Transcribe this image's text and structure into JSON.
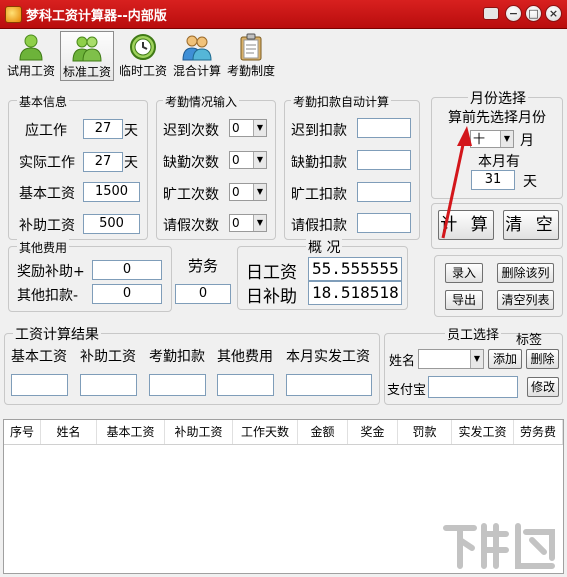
{
  "window": {
    "title": "梦科工资计算器--内部版"
  },
  "toolbar": [
    {
      "label": "试用工资",
      "icon": "person-icon"
    },
    {
      "label": "标准工资",
      "icon": "people-icon"
    },
    {
      "label": "临时工资",
      "icon": "clock-icon"
    },
    {
      "label": "混合计算",
      "icon": "users-icon"
    },
    {
      "label": "考勤制度",
      "icon": "clipboard-icon"
    }
  ],
  "basic": {
    "legend": "基本信息",
    "work_label": "应工作",
    "work_value": "27",
    "work_unit": "天",
    "actual_label": "实际工作",
    "actual_value": "27",
    "actual_unit": "天",
    "base_label": "基本工资",
    "base_value": "1500",
    "subsidy_label": "补助工资",
    "subsidy_value": "500"
  },
  "attendance": {
    "legend": "考勤情况输入",
    "rows": [
      {
        "label": "迟到次数",
        "value": "0"
      },
      {
        "label": "缺勤次数",
        "value": "0"
      },
      {
        "label": "旷工次数",
        "value": "0"
      },
      {
        "label": "请假次数",
        "value": "0"
      }
    ]
  },
  "deduction": {
    "legend": "考勤扣款自动计算",
    "rows": [
      {
        "label": "迟到扣款",
        "value": ""
      },
      {
        "label": "缺勤扣款",
        "value": ""
      },
      {
        "label": "旷工扣款",
        "value": ""
      },
      {
        "label": "请假扣款",
        "value": ""
      }
    ]
  },
  "month": {
    "legend": "月份选择",
    "hint": "算前先选择月份",
    "selected": "十",
    "unit": "月",
    "days_label": "本月有",
    "days_value": "31",
    "days_unit": "天"
  },
  "actions": {
    "calc": "计 算",
    "clear": "清 空"
  },
  "other_fees": {
    "legend": "其他费用",
    "bonus_label": "奖励补助+",
    "bonus_value": "0",
    "other_label": "其他扣款-",
    "other_value": "0"
  },
  "labor": {
    "label": "劳务",
    "value": "0"
  },
  "summary": {
    "legend": "概 况",
    "daily_wage_label": "日工资",
    "daily_wage_value": "55.555555",
    "daily_subsidy_label": "日补助",
    "daily_subsidy_value": "18.518518"
  },
  "record_buttons": {
    "enter": "录入",
    "delete_row": "删除该列",
    "export": "导出",
    "clear_list": "清空列表"
  },
  "result": {
    "legend": "工资计算结果",
    "columns": [
      "基本工资",
      "补助工资",
      "考勤扣款",
      "其他费用",
      "本月实发工资"
    ]
  },
  "employee": {
    "legend": "员工选择",
    "tag_label": "标签",
    "name_label": "姓名",
    "add": "添加",
    "delete": "删除",
    "alipay_label": "支付宝",
    "modify": "修改"
  },
  "table": {
    "columns": [
      "序号",
      "姓名",
      "基本工资",
      "补助工资",
      "工作天数",
      "金额",
      "奖金",
      "罚款",
      "实发工资",
      "劳务费"
    ]
  },
  "watermark": {
    "text": "下载吧"
  },
  "colors": {
    "titlebar": "#c81818",
    "arrow": "#d3161b",
    "toolbar_active": "#e7e7e7"
  }
}
